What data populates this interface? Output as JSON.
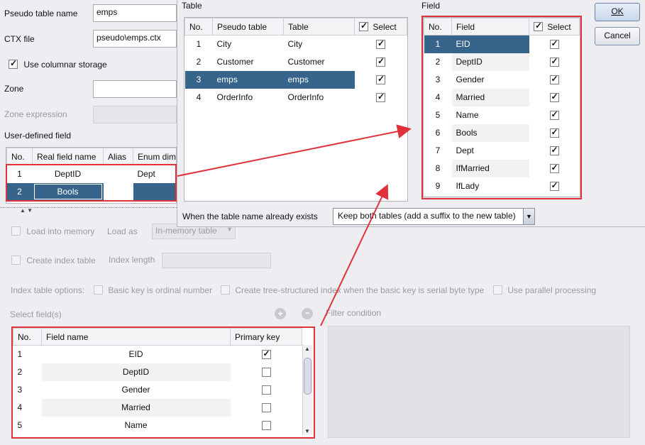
{
  "main": {
    "pseudo_table_name_label": "Pseudo table name",
    "pseudo_table_name_value": "emps",
    "ctx_file_label": "CTX file",
    "ctx_file_value": "pseudo\\emps.ctx",
    "columnar_label": "Use columnar storage",
    "zone_label": "Zone",
    "zone_expression_label": "Zone expression",
    "user_defined_label": "User-defined field",
    "udf_headers": [
      "No.",
      "Real field name",
      "Alias",
      "Enum dim"
    ],
    "udf_rows": [
      {
        "no": "1",
        "real": "DeptID",
        "alias": "",
        "enum": "Dept"
      },
      {
        "no": "2",
        "real": "Bools",
        "alias": "",
        "enum": ""
      }
    ],
    "load_into_memory_label": "Load into memory",
    "load_as_label": "Load as",
    "load_as_value": "In-memory table",
    "create_index_label": "Create index table",
    "index_length_label": "Index length",
    "index_options_label": "Index table options:",
    "basic_key_label": "Basic key is ordinal number",
    "tree_index_label": "Create tree-structured index when the basic key is serial byte type",
    "parallel_label": "Use parallel processing",
    "select_fields_label": "Select field(s)",
    "filter_label": "Filter condition",
    "sel_headers": [
      "No.",
      "Field name",
      "Primary key"
    ],
    "sel_rows": [
      {
        "no": "1",
        "name": "EID",
        "pk": true
      },
      {
        "no": "2",
        "name": "DeptID",
        "pk": false
      },
      {
        "no": "3",
        "name": "Gender",
        "pk": false
      },
      {
        "no": "4",
        "name": "Married",
        "pk": false
      },
      {
        "no": "5",
        "name": "Name",
        "pk": false
      }
    ]
  },
  "dialog": {
    "table_label": "Table",
    "field_label": "Field",
    "table_headers": [
      "No.",
      "Pseudo table",
      "Table",
      "Select"
    ],
    "tables": [
      {
        "no": "1",
        "pseudo": "City",
        "table": "City"
      },
      {
        "no": "2",
        "pseudo": "Customer",
        "table": "Customer"
      },
      {
        "no": "3",
        "pseudo": "emps",
        "table": "emps"
      },
      {
        "no": "4",
        "pseudo": "OrderInfo",
        "table": "OrderInfo"
      }
    ],
    "field_headers": [
      "No.",
      "Field",
      "Select"
    ],
    "fields": [
      {
        "no": "1",
        "name": "EID"
      },
      {
        "no": "2",
        "name": "DeptID"
      },
      {
        "no": "3",
        "name": "Gender"
      },
      {
        "no": "4",
        "name": "Married"
      },
      {
        "no": "5",
        "name": "Name"
      },
      {
        "no": "6",
        "name": "Bools"
      },
      {
        "no": "7",
        "name": "Dept"
      },
      {
        "no": "8",
        "name": "IfMarried"
      },
      {
        "no": "9",
        "name": "IfLady"
      }
    ],
    "exists_label": "When the table name already exists",
    "exists_value": "Keep both tables (add a suffix to the new table)",
    "ok_label": "OK",
    "cancel_label": "Cancel"
  },
  "colors": {
    "selection": "#36648b",
    "highlight": "#e0323a"
  }
}
